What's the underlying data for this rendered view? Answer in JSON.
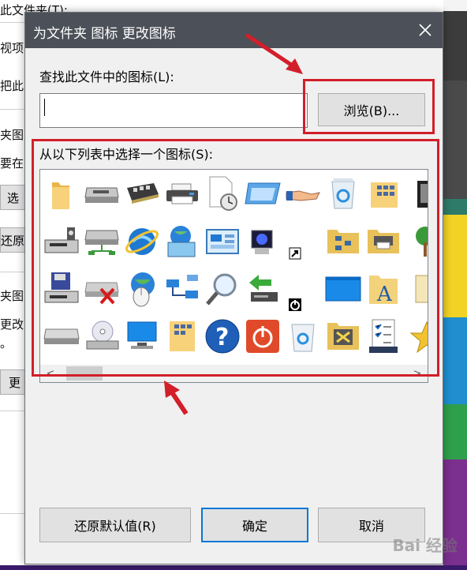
{
  "background": {
    "fragments": [
      "此文件夹(T):",
      "视项目",
      "把此",
      "夹图",
      "要在",
      "选",
      "还原",
      "夹图",
      "更改",
      "。",
      "更"
    ]
  },
  "dialog": {
    "title": "为文件夹 图标 更改图标",
    "find_label": "查找此文件中的图标(L):",
    "path_value": "",
    "browse_label": "浏览(B)...",
    "list_label": "从以下列表中选择一个图标(S):",
    "restore_label": "还原默认值(R)",
    "ok_label": "确定",
    "cancel_label": "取消"
  },
  "icons": [
    [
      "folder-icon",
      "removable-drive-icon",
      "memory-chip-icon",
      "printer-icon",
      "document-clock-icon",
      "window-app-icon",
      "shared-hand-icon",
      "recycle-bin-full-icon",
      "folder-grid-icon",
      "mirror-edge-icon"
    ],
    [
      "network-drive-icon",
      "drive-network-icon",
      "internet-explorer-icon",
      "globe-monitor-icon",
      "control-panel-icon",
      "screen-speaker-icon",
      "shortcut-arrow-icon",
      "network-folder-icon",
      "printer-folder-icon",
      "tree-icon"
    ],
    [
      "floppy-drive-icon",
      "drive-delete-icon",
      "globe-mouse-icon",
      "network-connection-icon",
      "magnifier-icon",
      "drive-arrow-icon",
      "power-overlay-icon",
      "blank-window-icon",
      "font-folder-icon",
      "document-small-icon"
    ],
    [
      "hard-drive-icon",
      "cd-drive-icon",
      "monitor-icon",
      "folder-list-icon",
      "help-icon",
      "shutdown-icon",
      "recycle-bin-empty-icon",
      "tools-folder-icon",
      "checklist-icon",
      "star-icon"
    ]
  ],
  "colors": {
    "titlebar": "#4c5058",
    "annotation_red": "#d21f2a",
    "primary_border": "#0078d7"
  },
  "watermark": "Bai 经验"
}
